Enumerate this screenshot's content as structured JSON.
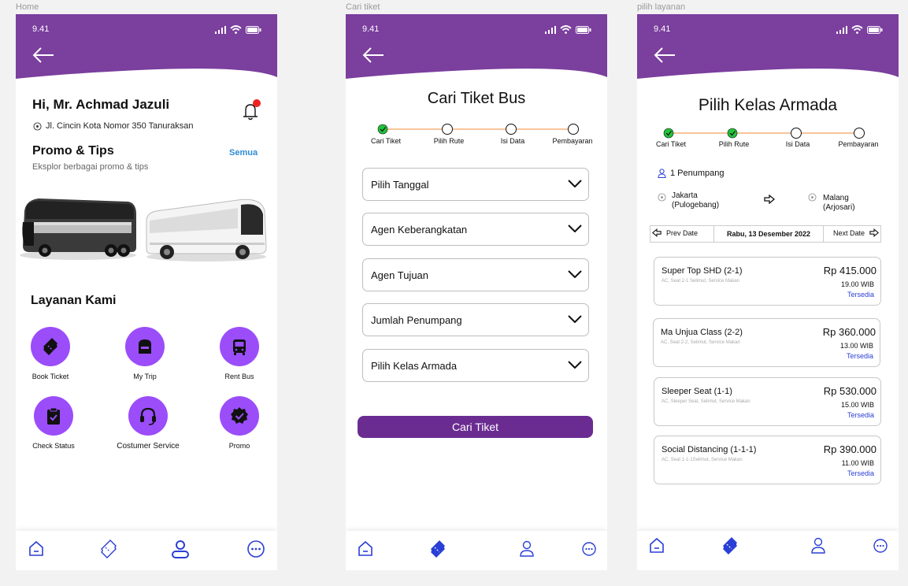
{
  "frames": {
    "home": "Home",
    "cari": "Cari tiket",
    "pilih": "pilih layanan"
  },
  "status": {
    "time": "9.41"
  },
  "colors": {
    "header": "#7b3f9e",
    "accent": "#9b4dfa",
    "button": "#6a2c91",
    "step_done": "#22c33a",
    "step_line": "#f4a261",
    "link_blue": "#2a3fd6"
  },
  "home": {
    "greeting": "Hi, Mr. Achmad Jazuli",
    "address": "Jl. Cincin Kota Nomor 350 Tanuraksan",
    "promo_title": "Promo & Tips",
    "promo_sub": "Eksplor berbagai promo & tips",
    "see_all": "Semua",
    "services_title": "Layanan Kami",
    "services": [
      {
        "label": "Book Ticket",
        "icon": "ticket-icon"
      },
      {
        "label": "My Trip",
        "icon": "bag-icon"
      },
      {
        "label": "Rent Bus",
        "icon": "bus-icon"
      },
      {
        "label": "Check Status",
        "icon": "clipboard-icon"
      },
      {
        "label": "Costumer Service",
        "icon": "headset-icon"
      },
      {
        "label": "Promo",
        "icon": "badge-icon"
      }
    ]
  },
  "steps": [
    "Cari Tiket",
    "Pilih Rute",
    "Isi Data",
    "Pembayaran"
  ],
  "cari": {
    "title": "Cari Tiket Bus",
    "fields": [
      "Pilih Tanggal",
      "Agen Keberangkatan",
      "Agen Tujuan",
      "Jumlah Penumpang",
      "Pilih Kelas Armada"
    ],
    "button": "Cari Tiket"
  },
  "kelas": {
    "title": "Pilih Kelas Armada",
    "passengers": "1 Penumpang",
    "origin": "Jakarta",
    "origin_sub": "(Pulogebang)",
    "dest": "Malang",
    "dest_sub": "(Arjosari)",
    "prev": "Prev Date",
    "date": "Rabu, 13 Desember 2022",
    "next": "Next Date",
    "cards": [
      {
        "name": "Super Top SHD (2-1)",
        "desc": "AC, Seat 2-1 Selimut, Service Makan",
        "price": "Rp 415.000",
        "time": "19.00 WIB",
        "status": "Tersedia"
      },
      {
        "name": "Ma Unjua Class (2-2)",
        "desc": "AC, Seat 2-2, Selimut, Service Makan",
        "price": "Rp 360.000",
        "time": "13.00 WIB",
        "status": "Tersedia"
      },
      {
        "name": "Sleeper Seat (1-1)",
        "desc": "AC, Sleeper Seat, Selimut, Service Makan",
        "price": "Rp 530.000",
        "time": "15.00 WIB",
        "status": "Tersedia"
      },
      {
        "name": "Social Distancing (1-1-1)",
        "desc": "AC, Seat 1-1-1Selimut, Service Makan",
        "price": "Rp 390.000",
        "time": "11.00 WIB",
        "status": "Tersedia"
      }
    ]
  }
}
